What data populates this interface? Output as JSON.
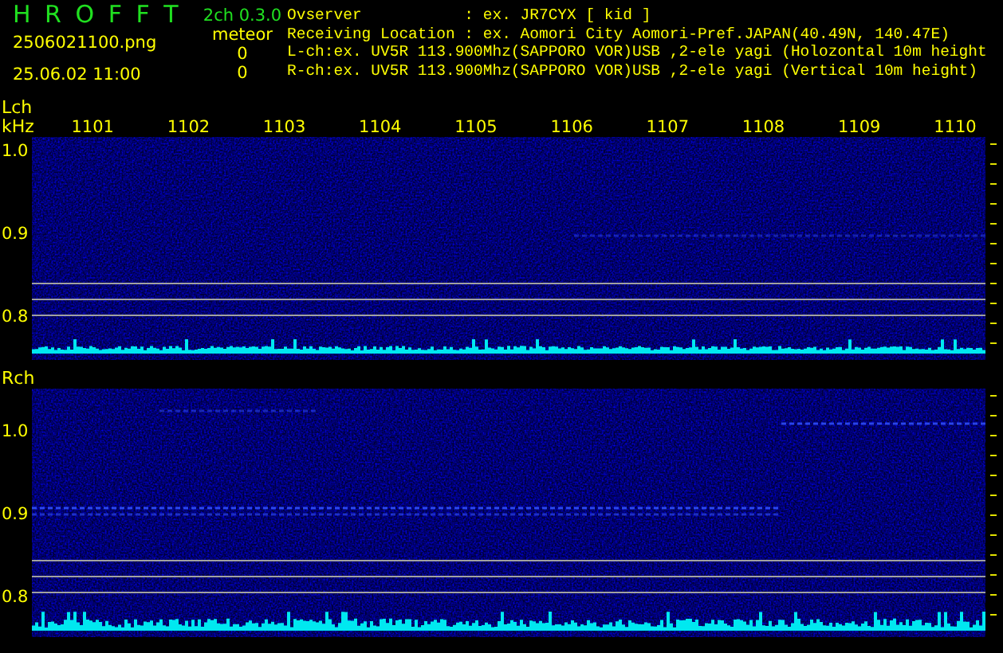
{
  "header": {
    "app_name": "H R O F F T",
    "file_name": "2506021100.png",
    "timestamp": "25.06.02 11:00",
    "version": "2ch 0.3.0",
    "counter_label": "meteor",
    "counts": [
      "0",
      "0"
    ],
    "info_lines": [
      "Ovserver           : ex. JR7CYX [ kid ]",
      "Receiving Location : ex. Aomori City Aomori-Pref.JAPAN(40.49N, 140.47E)",
      "L-ch:ex. UV5R 113.900Mhz(SAPPORO VOR)USB ,2-ele yagi (Holozontal 10m height",
      "R-ch:ex. UV5R 113.900Mhz(SAPPORO VOR)USB ,2-ele yagi (Vertical 10m height)"
    ]
  },
  "panels": [
    {
      "channel": "Lch",
      "unit": "kHz",
      "x_labels": [
        "1101",
        "1102",
        "1103",
        "1104",
        "1105",
        "1106",
        "1107",
        "1108",
        "1109",
        "1110"
      ],
      "y_labels": [
        "1.0",
        "0.9",
        "0.8"
      ]
    },
    {
      "channel": "Rch",
      "y_labels": [
        "1.0",
        "0.9",
        "0.8"
      ]
    }
  ]
}
